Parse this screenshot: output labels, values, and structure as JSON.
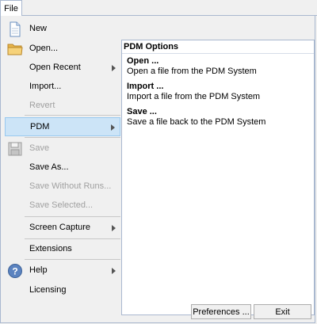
{
  "file_tab": {
    "label": "File"
  },
  "menu": {
    "new": "New",
    "open": "Open...",
    "open_recent": "Open Recent",
    "import": "Import...",
    "revert": "Revert",
    "pdm": "PDM",
    "save": "Save",
    "save_as": "Save As...",
    "save_without_runs": "Save Without Runs...",
    "save_selected": "Save Selected...",
    "screen_capture": "Screen Capture",
    "extensions": "Extensions",
    "help": "Help",
    "licensing": "Licensing"
  },
  "pdm_panel": {
    "title": "PDM Options",
    "items": [
      {
        "title": "Open ...",
        "description": "Open a file from the PDM System"
      },
      {
        "title": "Import ...",
        "description": "Import a file from the PDM System"
      },
      {
        "title": "Save ...",
        "description": "Save a file back to the PDM System"
      }
    ]
  },
  "buttons": {
    "preferences": "Preferences ...",
    "exit": "Exit"
  }
}
